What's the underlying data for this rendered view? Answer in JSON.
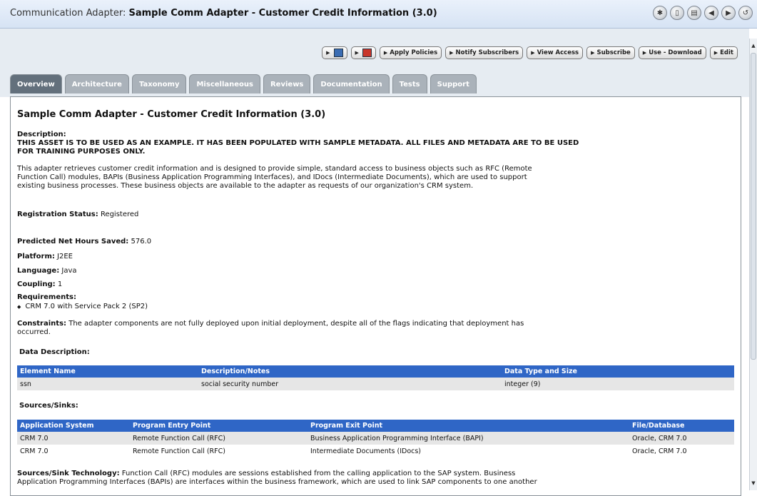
{
  "window": {
    "title_prefix": "Communication Adapter:",
    "title_main": "Sample Comm Adapter - Customer Credit Information (3.0)",
    "icons": [
      "asterisk-icon",
      "document-icon",
      "print-icon",
      "back-icon",
      "forward-icon",
      "refresh-icon"
    ]
  },
  "toolbar": {
    "buttons": [
      {
        "label": "",
        "icon": "save-icon"
      },
      {
        "label": "",
        "icon": "pdf-icon"
      },
      {
        "label": "Apply Policies"
      },
      {
        "label": "Notify Subscribers"
      },
      {
        "label": "View Access"
      },
      {
        "label": "Subscribe"
      },
      {
        "label": "Use - Download"
      },
      {
        "label": "Edit"
      }
    ]
  },
  "tabs": [
    {
      "label": "Overview",
      "active": true
    },
    {
      "label": "Architecture"
    },
    {
      "label": "Taxonomy"
    },
    {
      "label": "Miscellaneous"
    },
    {
      "label": "Reviews"
    },
    {
      "label": "Documentation"
    },
    {
      "label": "Tests"
    },
    {
      "label": "Support"
    }
  ],
  "overview": {
    "title": "Sample Comm Adapter - Customer Credit Information (3.0)",
    "description_label": "Description:",
    "description_caps_1": "THIS ASSET IS TO BE USED AS AN EXAMPLE. IT HAS BEEN POPULATED WITH SAMPLE METADATA. ALL FILES AND METADATA ARE TO BE USED",
    "description_caps_2": "FOR TRAINING PURPOSES ONLY.",
    "description_text_1": "This adapter retrieves customer credit information and is designed to provide simple, standard access to business objects such as RFC (Remote",
    "description_text_2": "Function Call) modules, BAPIs (Business Application Programming Interfaces), and IDocs (Intermediate Documents), which are used to support",
    "description_text_3": "existing business processes. These business objects are available to the adapter as requests of our organization's CRM system.",
    "registration_label": "Registration Status:",
    "registration_value": "Registered",
    "hours_label": "Predicted Net Hours Saved:",
    "hours_value": "576.0",
    "platform_label": "Platform:",
    "platform_value": "J2EE",
    "language_label": "Language:",
    "language_value": "Java",
    "coupling_label": "Coupling:",
    "coupling_value": "1",
    "requirements_label": "Requirements:",
    "requirements_item": "CRM 7.0 with Service Pack 2 (SP2)",
    "constraints_label": "Constraints:",
    "constraints_text_1": "The adapter components are not fully deployed upon initial deployment, despite all of the flags indicating that deployment has",
    "constraints_text_2": "occurred.",
    "data_description_label": "Data Description:",
    "data_table": {
      "headers": [
        "Element Name",
        "Description/Notes",
        "Data Type and Size"
      ],
      "rows": [
        [
          "ssn",
          "social security number",
          "integer (9)"
        ]
      ]
    },
    "sources_label": "Sources/Sinks:",
    "sources_table": {
      "headers": [
        "Application System",
        "Program Entry Point",
        "Program Exit Point",
        "File/Database"
      ],
      "rows": [
        [
          "CRM 7.0",
          "Remote Function Call (RFC)",
          "Business Application Programming Interface (BAPI)",
          "Oracle, CRM 7.0"
        ],
        [
          "CRM 7.0",
          "Remote Function Call (RFC)",
          "Intermediate Documents (IDocs)",
          "Oracle, CRM 7.0"
        ]
      ]
    },
    "tech_label": "Sources/Sink Technology:",
    "tech_text_1": "Function Call (RFC) modules are sessions established from the calling application to the SAP system. Business",
    "tech_text_2": "Application Programming Interfaces (BAPIs) are interfaces within the business framework, which are used to link SAP components to one another"
  },
  "colors": {
    "table_header": "#2f66c6",
    "tab_active": "#63707c",
    "tab_inactive": "#aab2ba"
  }
}
